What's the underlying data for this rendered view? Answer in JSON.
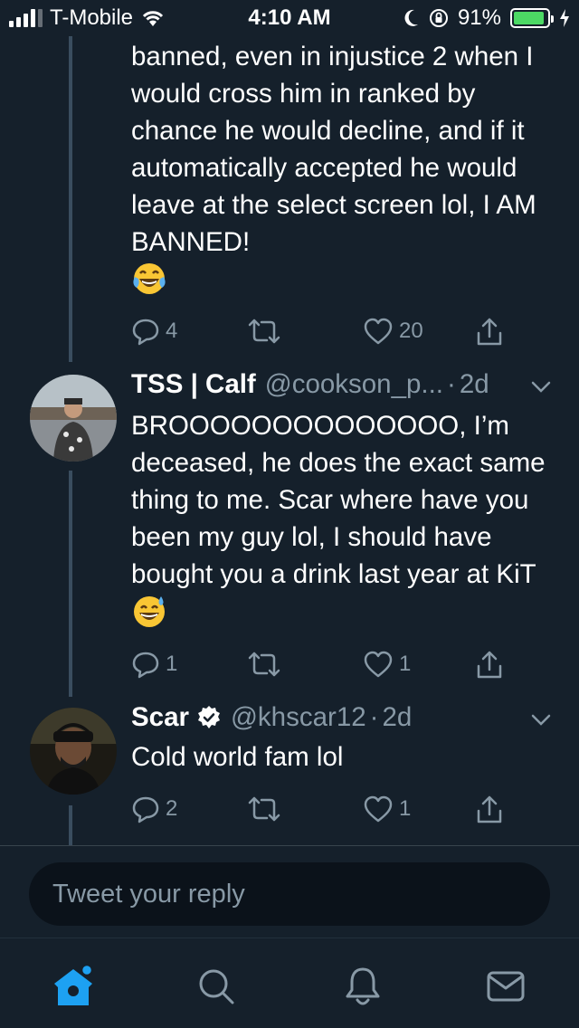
{
  "status_bar": {
    "carrier": "T-Mobile",
    "time": "4:10 AM",
    "battery_percent": "91%",
    "battery_level": 0.91
  },
  "tweets": [
    {
      "text": "banned, even in injustice 2 when I would cross him in ranked by chance he would decline, and if it automatically accepted he would leave at the select screen lol, I AM BANNED!",
      "emoji": "face-with-tears-of-joy",
      "replies": "4",
      "retweets": "",
      "likes": "20"
    },
    {
      "name": "TSS | Calf",
      "handle": "@cookson_p...",
      "time": "2d",
      "text": "BROOOOOOOOOOOOOO, I’m deceased, he does the exact same thing to me. Scar where have you been my guy lol, I should have bought you a drink last year at KiT",
      "emoji": "grinning-face-with-sweat",
      "replies": "1",
      "retweets": "",
      "likes": "1"
    },
    {
      "name": "Scar",
      "verified": true,
      "handle": "@khscar12",
      "time": "2d",
      "text": "Cold world fam lol",
      "replies": "2",
      "retweets": "",
      "likes": "1"
    }
  ],
  "reply_box": {
    "placeholder": "Tweet your reply"
  },
  "bottom_nav": {
    "items": [
      "home-icon",
      "search-icon",
      "notifications-icon",
      "messages-icon"
    ],
    "active": "home-icon",
    "has_new_dot": true
  },
  "colors": {
    "background": "#15202b",
    "secondary_text": "#8899a6",
    "accent": "#1da1f2",
    "battery": "#4cd964"
  }
}
